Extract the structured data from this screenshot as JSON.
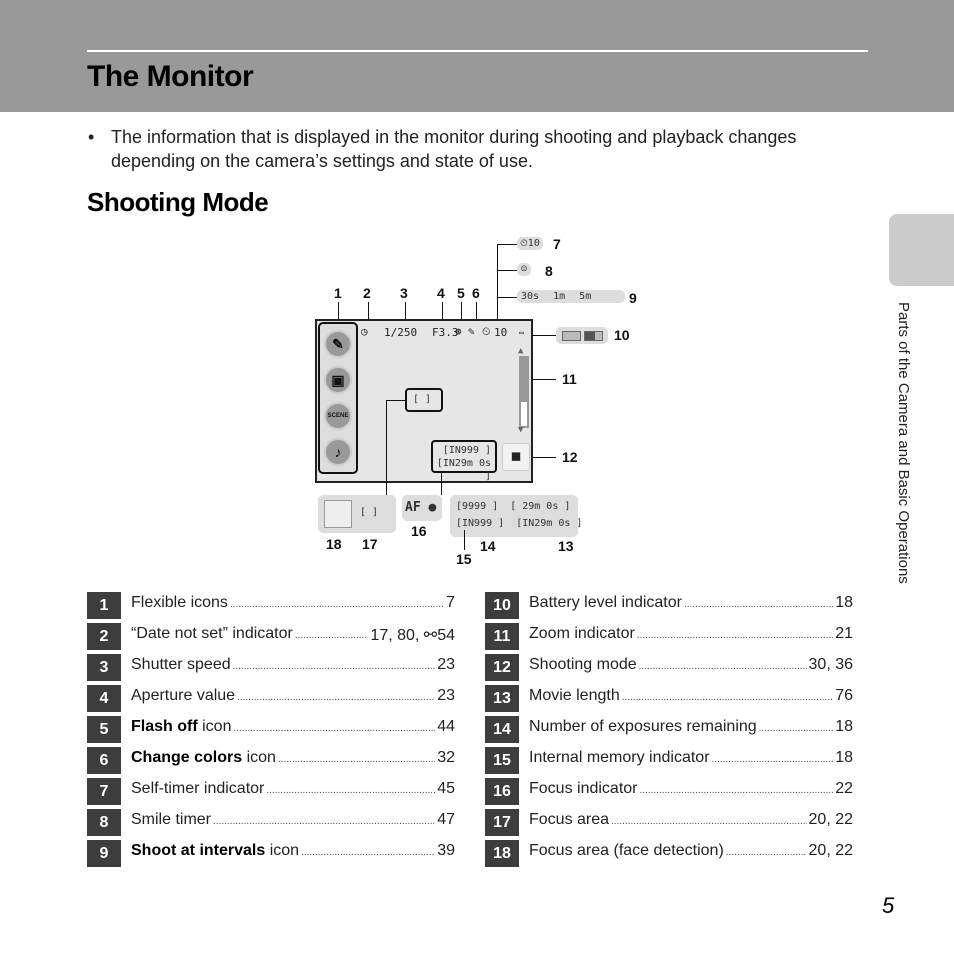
{
  "header": {
    "title": "The Monitor"
  },
  "intro": {
    "bullet": "•",
    "text": "The information that is displayed in the monitor during shooting and playback changes depending on the camera’s settings and state of use."
  },
  "section": {
    "title": "Shooting Mode"
  },
  "side_tab": {
    "label": "Parts of the Camera and Basic Operations"
  },
  "page_number": "5",
  "diagram": {
    "monitor": {
      "shutter_speed": "1/250",
      "aperture": "F3.3",
      "self_timer": "10",
      "focus_bracket": "[  ]",
      "exposures_remaining": "[IN999 ]",
      "movie_length": "[IN29m 0s ]",
      "zoom_level_fraction": 0.35,
      "flexible_icons": [
        "paint-brush-icon",
        "frame-icon",
        "scene-icon",
        "music-note-icon"
      ],
      "flexible_icon_glyphs": [
        "✎",
        "▣",
        "SCENE",
        "♪"
      ],
      "shooting_mode_icon": "camera-icon"
    },
    "extras": {
      "self_timer": "⏲10",
      "smile_timer": "☺",
      "intervals": [
        "30s",
        "1m",
        "5m"
      ],
      "focus_indicator": "AF ●",
      "focus_area": "[  ]",
      "exposures_row1": "[9999 ]",
      "movie_row1": "[  29m 0s ]",
      "exposures_row2": "[IN999 ]",
      "movie_row2": "[IN29m 0s ]"
    },
    "callouts": [
      "1",
      "2",
      "3",
      "4",
      "5",
      "6",
      "7",
      "8",
      "9",
      "10",
      "11",
      "12",
      "13",
      "14",
      "15",
      "16",
      "17",
      "18"
    ]
  },
  "table_left": [
    {
      "num": "1",
      "bold": "",
      "label": "Flexible icons",
      "page": "7"
    },
    {
      "num": "2",
      "bold": "",
      "label": "“Date not set” indicator",
      "page": "17, 80, ⚯54"
    },
    {
      "num": "3",
      "bold": "",
      "label": "Shutter speed",
      "page": "23"
    },
    {
      "num": "4",
      "bold": "",
      "label": "Aperture value",
      "page": "23"
    },
    {
      "num": "5",
      "bold": "Flash off",
      "label": " icon",
      "page": "44"
    },
    {
      "num": "6",
      "bold": "Change colors",
      "label": " icon",
      "page": "32"
    },
    {
      "num": "7",
      "bold": "",
      "label": "Self-timer indicator",
      "page": "45"
    },
    {
      "num": "8",
      "bold": "",
      "label": "Smile timer",
      "page": "47"
    },
    {
      "num": "9",
      "bold": "Shoot at intervals",
      "label": " icon",
      "page": "39"
    }
  ],
  "table_right": [
    {
      "num": "10",
      "bold": "",
      "label": "Battery level indicator",
      "page": "18"
    },
    {
      "num": "11",
      "bold": "",
      "label": "Zoom indicator",
      "page": "21"
    },
    {
      "num": "12",
      "bold": "",
      "label": "Shooting mode",
      "page": "30, 36"
    },
    {
      "num": "13",
      "bold": "",
      "label": "Movie length",
      "page": "76"
    },
    {
      "num": "14",
      "bold": "",
      "label": "Number of exposures remaining",
      "page": "18"
    },
    {
      "num": "15",
      "bold": "",
      "label": "Internal memory indicator",
      "page": "18"
    },
    {
      "num": "16",
      "bold": "",
      "label": "Focus indicator",
      "page": "22"
    },
    {
      "num": "17",
      "bold": "",
      "label": "Focus area",
      "page": "20, 22"
    },
    {
      "num": "18",
      "bold": "",
      "label": "Focus area (face detection)",
      "page": "20, 22"
    }
  ]
}
